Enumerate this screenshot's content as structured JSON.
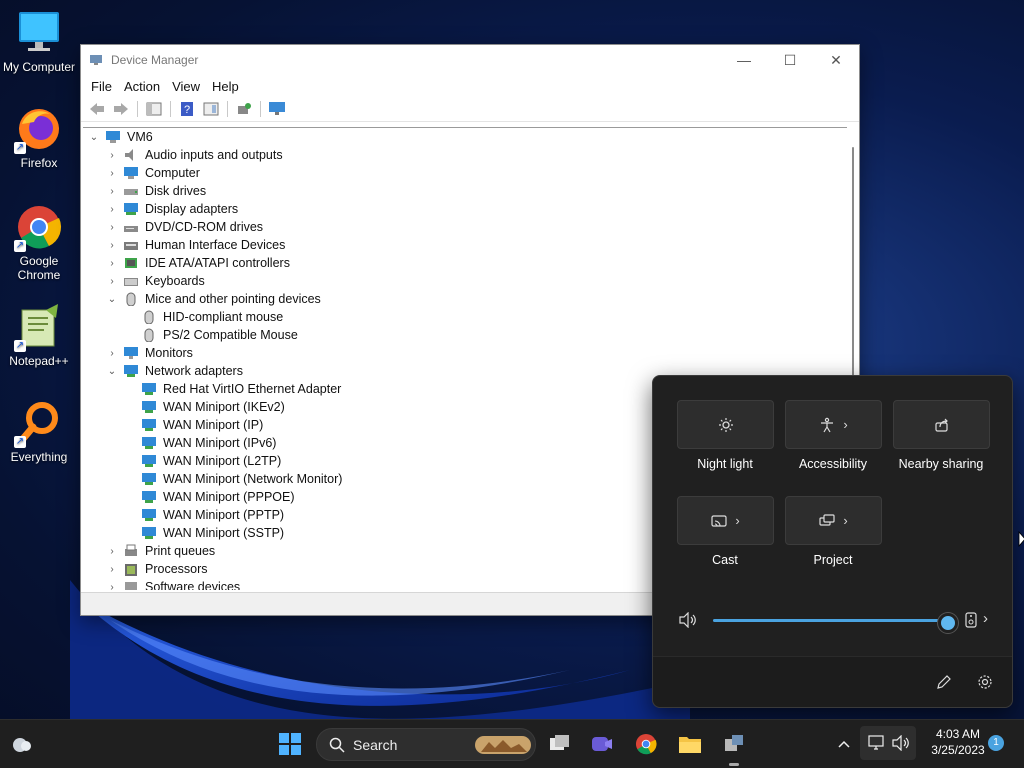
{
  "desktop": {
    "icons": [
      {
        "label": "My Computer"
      },
      {
        "label": "Firefox"
      },
      {
        "label": "Google Chrome"
      },
      {
        "label": "Notepad++"
      },
      {
        "label": "Everything"
      }
    ]
  },
  "window": {
    "title": "Device Manager",
    "menu": [
      "File",
      "Action",
      "View",
      "Help"
    ],
    "tree": {
      "root": "VM6",
      "categories": [
        {
          "label": "Audio inputs and outputs",
          "expanded": false,
          "children": []
        },
        {
          "label": "Computer",
          "expanded": false,
          "children": []
        },
        {
          "label": "Disk drives",
          "expanded": false,
          "children": []
        },
        {
          "label": "Display adapters",
          "expanded": false,
          "children": []
        },
        {
          "label": "DVD/CD-ROM drives",
          "expanded": false,
          "children": []
        },
        {
          "label": "Human Interface Devices",
          "expanded": false,
          "children": []
        },
        {
          "label": "IDE ATA/ATAPI controllers",
          "expanded": false,
          "children": []
        },
        {
          "label": "Keyboards",
          "expanded": false,
          "children": []
        },
        {
          "label": "Mice and other pointing devices",
          "expanded": true,
          "children": [
            "HID-compliant mouse",
            "PS/2 Compatible Mouse"
          ]
        },
        {
          "label": "Monitors",
          "expanded": false,
          "children": []
        },
        {
          "label": "Network adapters",
          "expanded": true,
          "children": [
            "Red Hat VirtIO Ethernet Adapter",
            "WAN Miniport (IKEv2)",
            "WAN Miniport (IP)",
            "WAN Miniport (IPv6)",
            "WAN Miniport (L2TP)",
            "WAN Miniport (Network Monitor)",
            "WAN Miniport (PPPOE)",
            "WAN Miniport (PPTP)",
            "WAN Miniport (SSTP)"
          ]
        },
        {
          "label": "Print queues",
          "expanded": false,
          "children": []
        },
        {
          "label": "Processors",
          "expanded": false,
          "children": []
        },
        {
          "label": "Software devices",
          "expanded": false,
          "children": []
        }
      ]
    }
  },
  "quick_settings": {
    "tiles": [
      {
        "label": "Night light",
        "icon": "night-light-icon",
        "has_arrow": false
      },
      {
        "label": "Accessibility",
        "icon": "accessibility-icon",
        "has_arrow": true
      },
      {
        "label": "Nearby sharing",
        "icon": "share-icon",
        "has_arrow": false
      },
      {
        "label": "Cast",
        "icon": "cast-icon",
        "has_arrow": true
      },
      {
        "label": "Project",
        "icon": "project-icon",
        "has_arrow": true
      }
    ],
    "volume_percent": 100
  },
  "taskbar": {
    "search_label": "Search",
    "time": "4:03 AM",
    "date": "3/25/2023",
    "notification_count": "1"
  },
  "colors": {
    "accent": "#4aa3e0",
    "panel_bg": "#202020",
    "taskbar_bg": "#1f1f1f"
  }
}
